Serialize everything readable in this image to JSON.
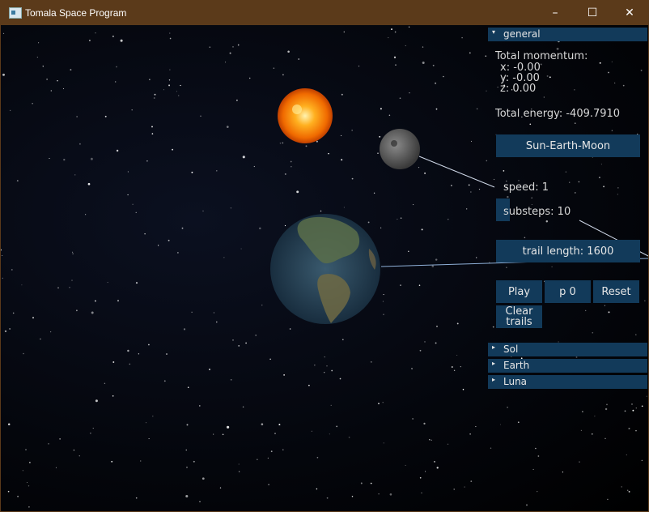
{
  "window": {
    "title": "Tomala Space Program"
  },
  "controls": {
    "minimize": "–",
    "maximize": "☐",
    "close": "✕"
  },
  "panel": {
    "general_label": "general",
    "momentum_title": "Total momentum:",
    "momentum_x": "x: -0.00",
    "momentum_y": "y: -0.00",
    "momentum_z": "z: 0.00",
    "energy": "Total energy: -409.7910",
    "preset_button": "Sun-Earth-Moon",
    "speed": "speed: 1",
    "substeps": "substeps: 10",
    "trail_length": "trail length: 1600",
    "play": "Play",
    "p0": "p 0",
    "reset": "Reset",
    "clear_trails_line1": "Clear",
    "clear_trails_line2": "trails",
    "bodies": [
      "Sol",
      "Earth",
      "Luna"
    ]
  }
}
